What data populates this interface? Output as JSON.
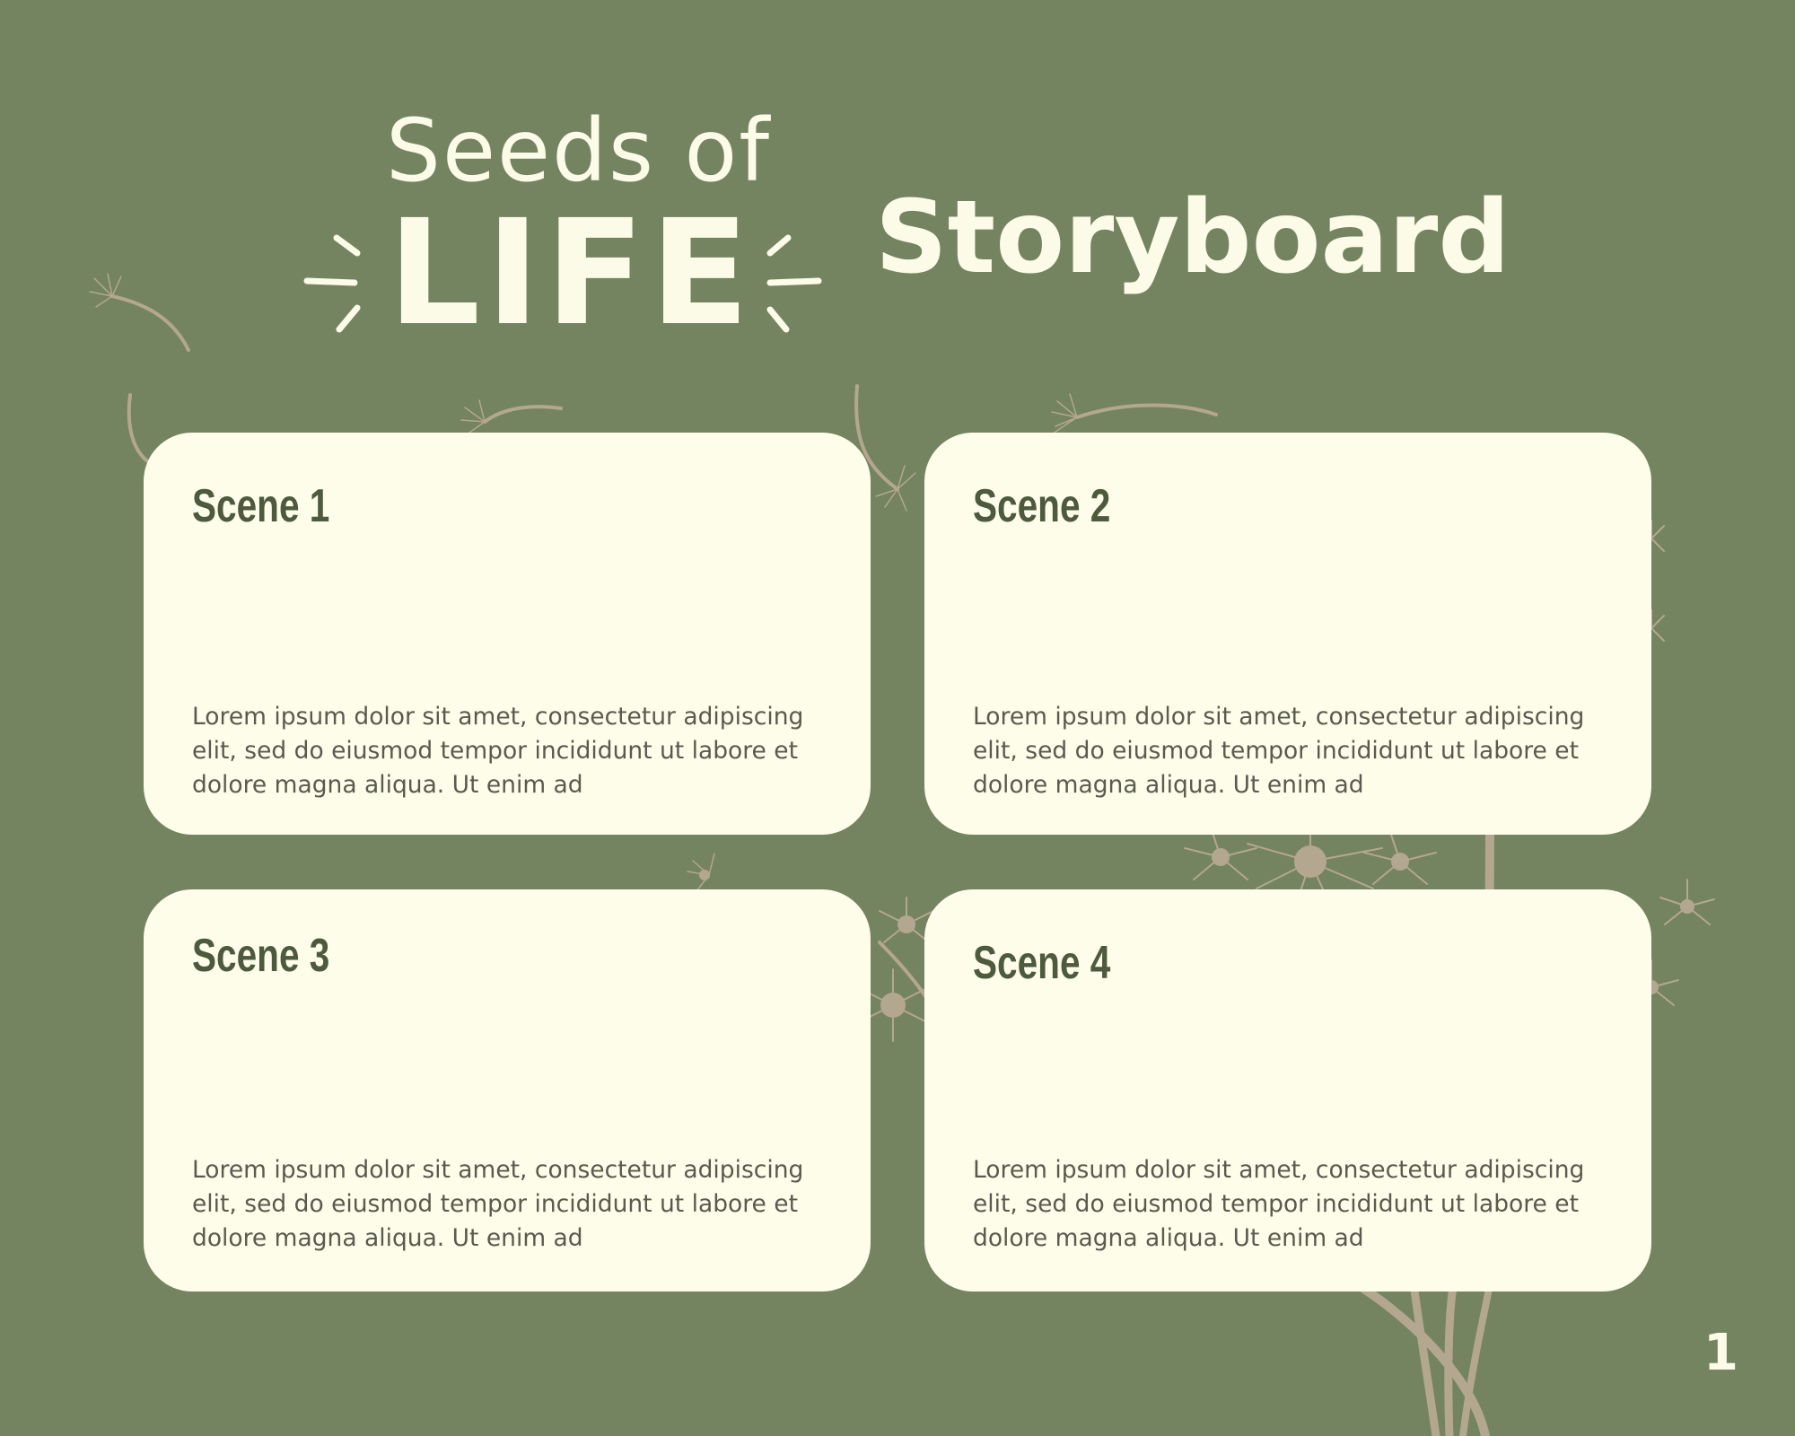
{
  "title": {
    "seeds_of": "Seeds of",
    "life": "LIFE",
    "storyboard": "Storyboard"
  },
  "scenes": [
    {
      "title": "Scene 1",
      "text": "Lorem ipsum dolor sit amet, consectetur adipiscing elit, sed do eiusmod tempor incididunt ut labore et dolore magna aliqua. Ut enim ad"
    },
    {
      "title": "Scene 2",
      "text": "Lorem ipsum dolor sit amet, consectetur adipiscing elit, sed do eiusmod tempor incididunt ut labore et dolore magna aliqua. Ut enim ad"
    },
    {
      "title": "Scene 3",
      "text": "Lorem ipsum dolor sit amet, consectetur adipiscing elit, sed do eiusmod tempor incididunt ut labore et dolore magna aliqua. Ut enim ad"
    },
    {
      "title": "Scene 4",
      "text": "Lorem ipsum dolor sit amet, consectetur adipiscing elit, sed do eiusmod tempor incididunt ut labore et dolore magna aliqua. Ut enim ad"
    }
  ],
  "page_number": "1",
  "colors": {
    "background": "#748360",
    "card": "#fdfde9",
    "title_text": "#fbfbe8",
    "scene_title": "#4d5a3d",
    "body_text": "#5a5a50",
    "decoration": "#b3a88f"
  },
  "icons": {
    "decoration": "dandelion-icon"
  }
}
